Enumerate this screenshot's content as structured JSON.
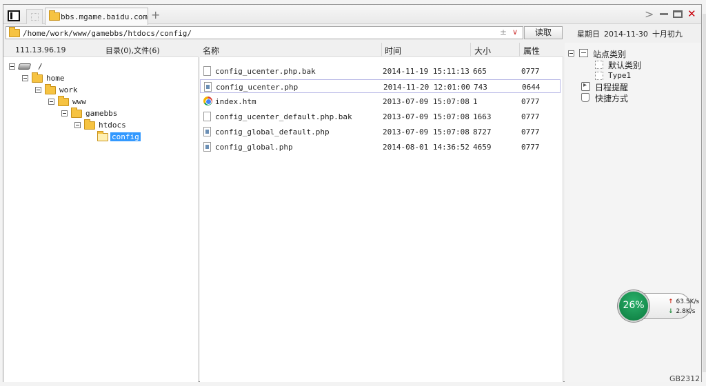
{
  "tabbar": {
    "active_tab_label": "bbs.mgame.baidu.com",
    "new_tab_symbol": "+",
    "chevron_symbol": ">",
    "close_symbol": "✕"
  },
  "address": {
    "path": "/home/work/www/gamebbs/htdocs/config/",
    "plusminus": "±",
    "caret": "∨",
    "read_button": "读取"
  },
  "date": {
    "weekday": "星期日",
    "date": "2014-11-30",
    "lunar": "十月初九"
  },
  "left": {
    "ip": "111.13.96.19",
    "counts": "目录(0),文件(6)",
    "tree": [
      {
        "label": "/"
      },
      {
        "label": "home"
      },
      {
        "label": "work"
      },
      {
        "label": "www"
      },
      {
        "label": "gamebbs"
      },
      {
        "label": "htdocs"
      },
      {
        "label": "config"
      }
    ]
  },
  "list": {
    "columns": [
      "名称",
      "时间",
      "大小",
      "属性"
    ],
    "files": [
      {
        "name": "config_ucenter.php.bak",
        "time": "2014-11-19 15:11:13",
        "size": "665",
        "attr": "0777",
        "icon": "blank-file-icon"
      },
      {
        "name": "config_ucenter.php",
        "time": "2014-11-20 12:01:00",
        "size": "743",
        "attr": "0644",
        "icon": "php-file-icon"
      },
      {
        "name": "index.htm",
        "time": "2013-07-09 15:07:08",
        "size": "1",
        "attr": "0777",
        "icon": "chrome-icon"
      },
      {
        "name": "config_ucenter_default.php.bak",
        "time": "2013-07-09 15:07:08",
        "size": "1663",
        "attr": "0777",
        "icon": "blank-file-icon"
      },
      {
        "name": "config_global_default.php",
        "time": "2013-07-09 15:07:08",
        "size": "8727",
        "attr": "0777",
        "icon": "php-file-icon"
      },
      {
        "name": "config_global.php",
        "time": "2014-08-01 14:36:52",
        "size": "4659",
        "attr": "0777",
        "icon": "php-file-icon"
      }
    ]
  },
  "right": {
    "site_categories": "站点类别",
    "default_category": "默认类别",
    "type1": "Type1",
    "schedule": "日程提醒",
    "shortcuts": "快捷方式"
  },
  "network": {
    "percent": "26%",
    "up": "63.5K/s",
    "down": "2.8K/s"
  },
  "status": {
    "encoding": "GB2312"
  },
  "colors": {
    "selection": "#3399ff",
    "close": "#c8000a",
    "net_green": "#0b7a3e"
  }
}
